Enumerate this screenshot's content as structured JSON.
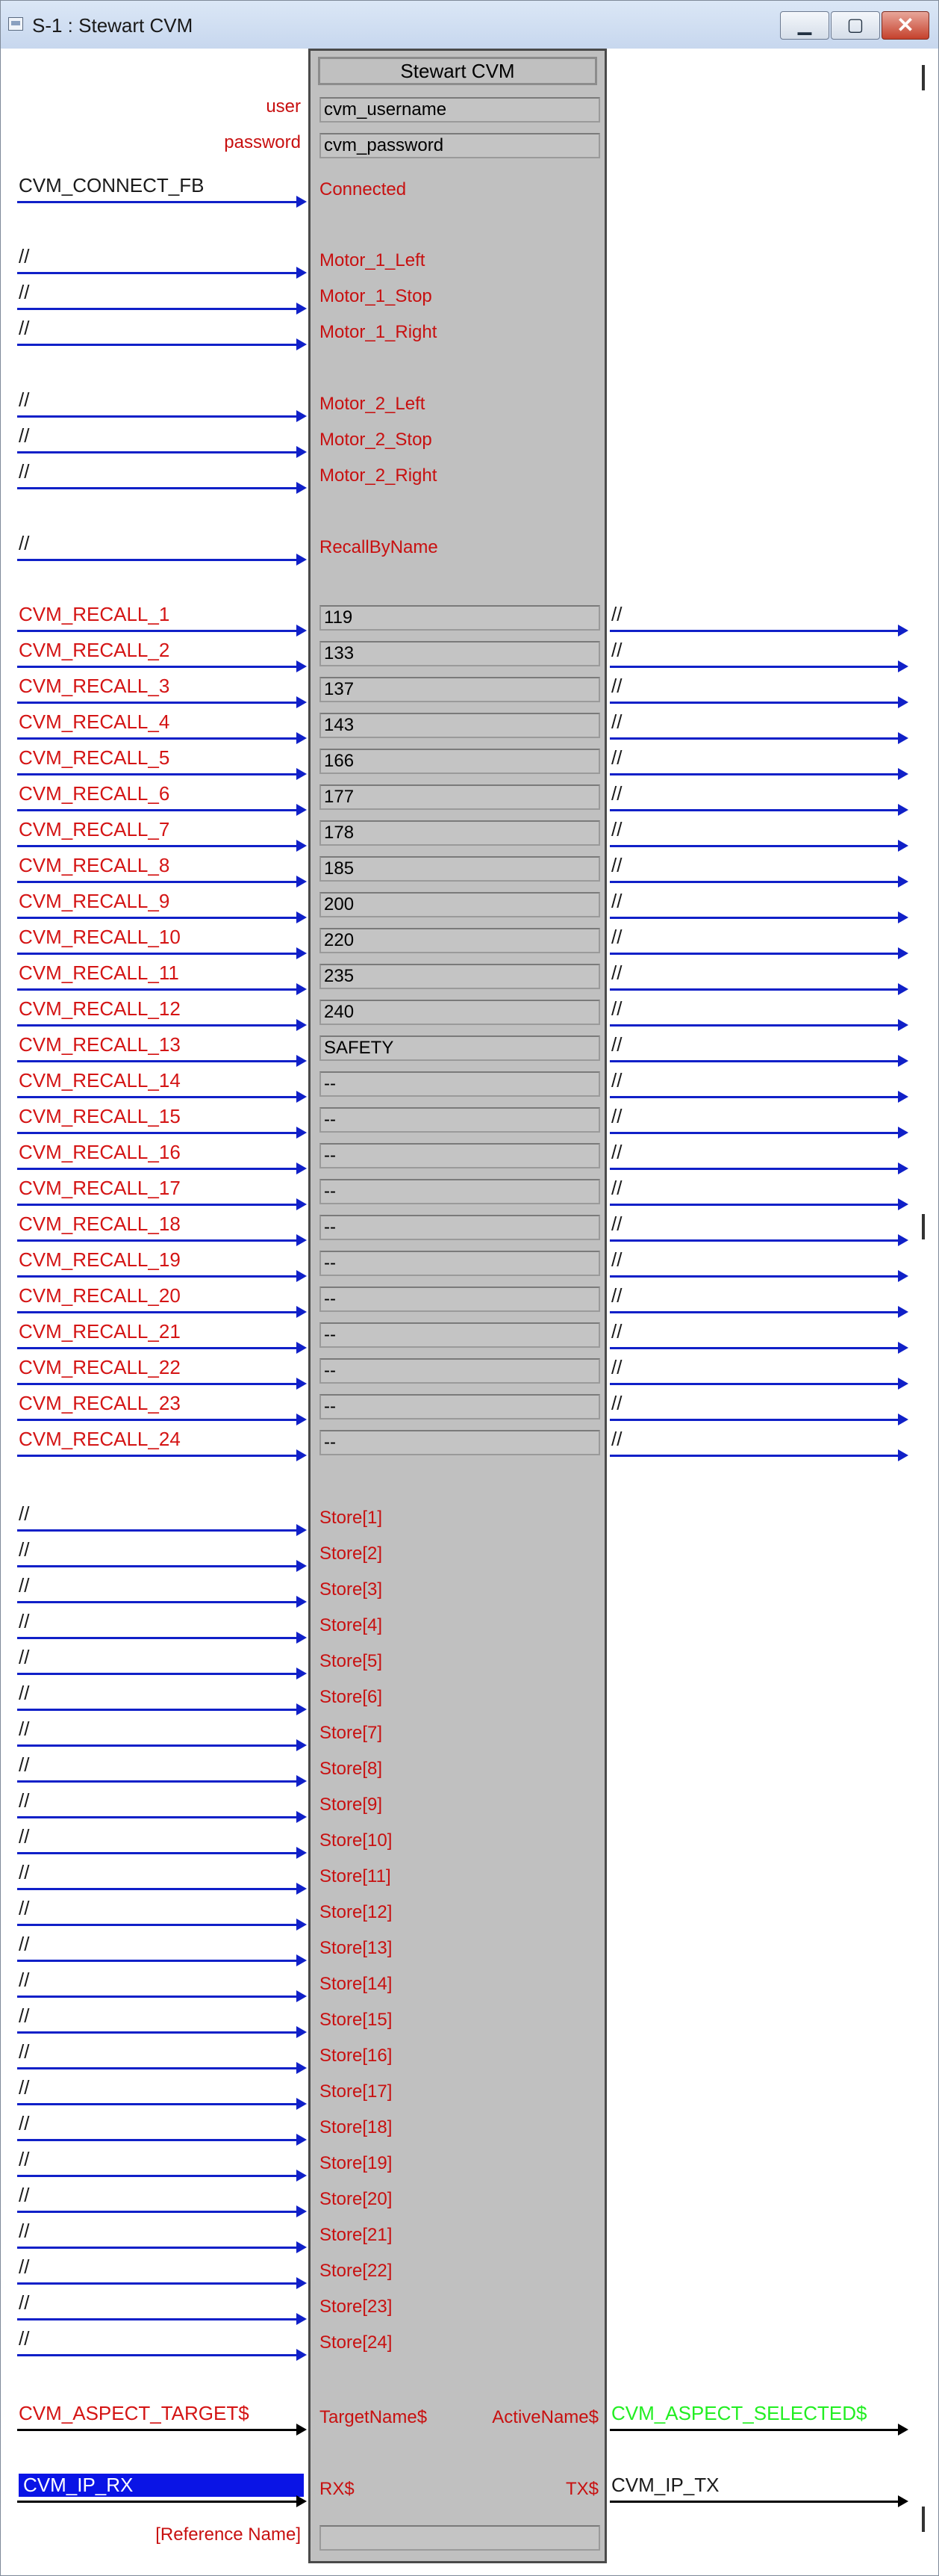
{
  "window": {
    "title": "S-1 : Stewart CVM",
    "min_glyph": "▁",
    "max_glyph": "▢",
    "close_glyph": "✕"
  },
  "symbol": {
    "title": "Stewart CVM",
    "params": [
      {
        "label": "user",
        "value": "cvm_username"
      },
      {
        "label": "password",
        "value": "cvm_password"
      }
    ]
  },
  "connect": {
    "signal": "CVM_CONNECT_FB",
    "input": "Connected"
  },
  "motor_inputs": [
    {
      "signal": "//",
      "input": "Motor_1_Left"
    },
    {
      "signal": "//",
      "input": "Motor_1_Stop"
    },
    {
      "signal": "//",
      "input": "Motor_1_Right"
    },
    {
      "signal": "//",
      "input": "Motor_2_Left"
    },
    {
      "signal": "//",
      "input": "Motor_2_Stop"
    },
    {
      "signal": "//",
      "input": "Motor_2_Right"
    },
    {
      "signal": "//",
      "input": "RecallByName"
    }
  ],
  "recalls": [
    {
      "signal": "CVM_RECALL_1",
      "value": "119",
      "output": "//"
    },
    {
      "signal": "CVM_RECALL_2",
      "value": "133",
      "output": "//"
    },
    {
      "signal": "CVM_RECALL_3",
      "value": "137",
      "output": "//"
    },
    {
      "signal": "CVM_RECALL_4",
      "value": "143",
      "output": "//"
    },
    {
      "signal": "CVM_RECALL_5",
      "value": "166",
      "output": "//"
    },
    {
      "signal": "CVM_RECALL_6",
      "value": "177",
      "output": "//"
    },
    {
      "signal": "CVM_RECALL_7",
      "value": "178",
      "output": "//"
    },
    {
      "signal": "CVM_RECALL_8",
      "value": "185",
      "output": "//"
    },
    {
      "signal": "CVM_RECALL_9",
      "value": "200",
      "output": "//"
    },
    {
      "signal": "CVM_RECALL_10",
      "value": "220",
      "output": "//"
    },
    {
      "signal": "CVM_RECALL_11",
      "value": "235",
      "output": "//"
    },
    {
      "signal": "CVM_RECALL_12",
      "value": "240",
      "output": "//"
    },
    {
      "signal": "CVM_RECALL_13",
      "value": "SAFETY",
      "output": "//"
    },
    {
      "signal": "CVM_RECALL_14",
      "value": "--",
      "output": "//"
    },
    {
      "signal": "CVM_RECALL_15",
      "value": "--",
      "output": "//"
    },
    {
      "signal": "CVM_RECALL_16",
      "value": "--",
      "output": "//"
    },
    {
      "signal": "CVM_RECALL_17",
      "value": "--",
      "output": "//"
    },
    {
      "signal": "CVM_RECALL_18",
      "value": "--",
      "output": "//"
    },
    {
      "signal": "CVM_RECALL_19",
      "value": "--",
      "output": "//"
    },
    {
      "signal": "CVM_RECALL_20",
      "value": "--",
      "output": "//"
    },
    {
      "signal": "CVM_RECALL_21",
      "value": "--",
      "output": "//"
    },
    {
      "signal": "CVM_RECALL_22",
      "value": "--",
      "output": "//"
    },
    {
      "signal": "CVM_RECALL_23",
      "value": "--",
      "output": "//"
    },
    {
      "signal": "CVM_RECALL_24",
      "value": "--",
      "output": "//"
    }
  ],
  "stores": [
    {
      "signal": "//",
      "input": "Store[1]"
    },
    {
      "signal": "//",
      "input": "Store[2]"
    },
    {
      "signal": "//",
      "input": "Store[3]"
    },
    {
      "signal": "//",
      "input": "Store[4]"
    },
    {
      "signal": "//",
      "input": "Store[5]"
    },
    {
      "signal": "//",
      "input": "Store[6]"
    },
    {
      "signal": "//",
      "input": "Store[7]"
    },
    {
      "signal": "//",
      "input": "Store[8]"
    },
    {
      "signal": "//",
      "input": "Store[9]"
    },
    {
      "signal": "//",
      "input": "Store[10]"
    },
    {
      "signal": "//",
      "input": "Store[11]"
    },
    {
      "signal": "//",
      "input": "Store[12]"
    },
    {
      "signal": "//",
      "input": "Store[13]"
    },
    {
      "signal": "//",
      "input": "Store[14]"
    },
    {
      "signal": "//",
      "input": "Store[15]"
    },
    {
      "signal": "//",
      "input": "Store[16]"
    },
    {
      "signal": "//",
      "input": "Store[17]"
    },
    {
      "signal": "//",
      "input": "Store[18]"
    },
    {
      "signal": "//",
      "input": "Store[19]"
    },
    {
      "signal": "//",
      "input": "Store[20]"
    },
    {
      "signal": "//",
      "input": "Store[21]"
    },
    {
      "signal": "//",
      "input": "Store[22]"
    },
    {
      "signal": "//",
      "input": "Store[23]"
    },
    {
      "signal": "//",
      "input": "Store[24]"
    }
  ],
  "aspect": {
    "signal": "CVM_ASPECT_TARGET$",
    "input": "TargetName$",
    "output": "ActiveName$",
    "out_signal": "CVM_ASPECT_SELECTED$"
  },
  "ip": {
    "signal": "CVM_IP_RX",
    "input": "RX$",
    "output": "TX$",
    "out_signal": "CVM_IP_TX"
  },
  "reference": {
    "label": "[Reference Name]",
    "value": ""
  },
  "colors": {
    "signal_red": "#d41414",
    "pin_red": "#c81010",
    "wire_blue": "#1020c8",
    "selected_green": "#22ee22",
    "highlight": "#0a14e6",
    "symbol_gray": "#c0c0c0"
  }
}
